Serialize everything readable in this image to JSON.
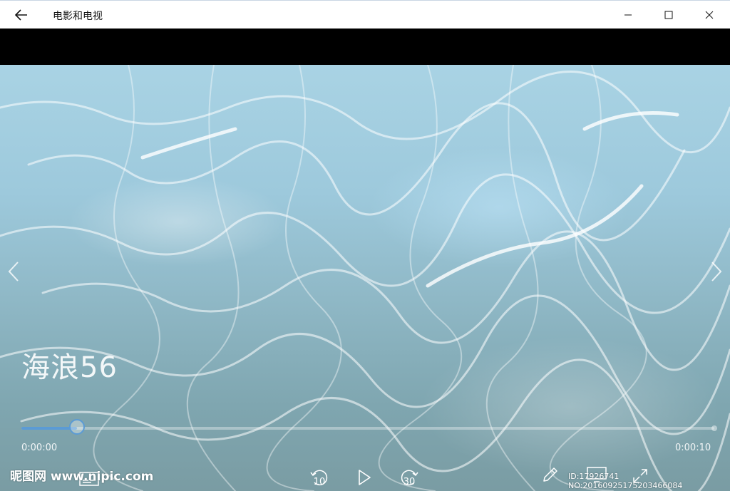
{
  "window": {
    "app_title": "电影和电视",
    "icons": {
      "back": "back-arrow-icon",
      "minimize": "minimize-icon",
      "maximize": "maximize-icon",
      "close": "close-icon"
    }
  },
  "player": {
    "video_title": "海浪56",
    "time_current": "0:00:00",
    "time_total": "0:00:10",
    "progress_fraction": 0.08,
    "skip_back_seconds": "10",
    "skip_forward_seconds": "30",
    "accent_color": "#5b9bd5",
    "icons": {
      "prev": "chevron-left-icon",
      "next": "chevron-right-icon",
      "subtitles": "subtitles-icon",
      "skip_back": "skip-back-icon",
      "play": "play-icon",
      "skip_forward": "skip-forward-icon",
      "edit": "pencil-icon",
      "cast": "cast-icon",
      "fullscreen": "fullscreen-icon"
    }
  },
  "watermark": {
    "left_text": "昵图网 www.nipic.com",
    "right_text": "ID:17926741 NO:20160925175203466084"
  }
}
